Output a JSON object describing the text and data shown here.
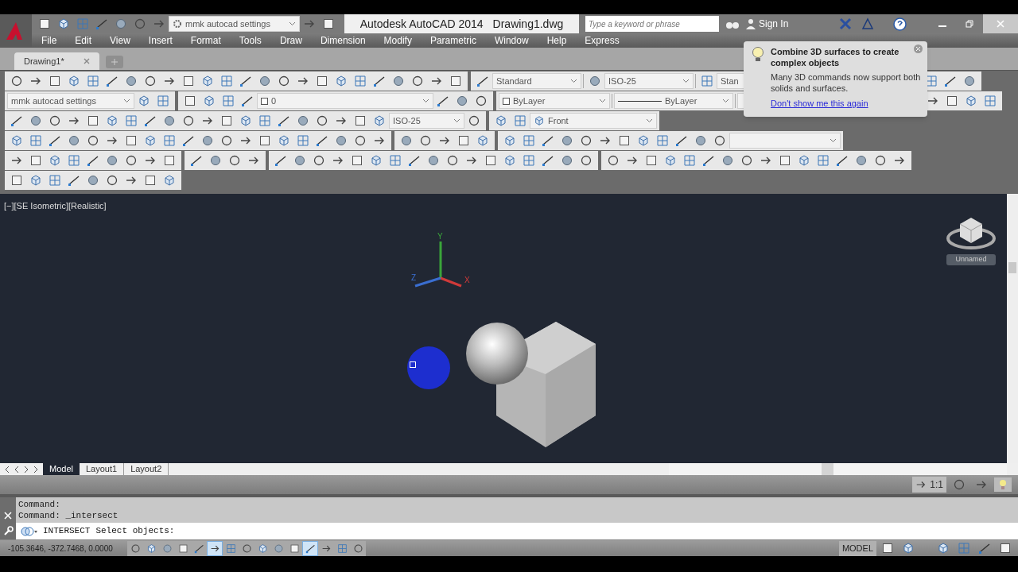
{
  "quick_access": {
    "workspace": "mmk autocad settings"
  },
  "title": {
    "app": "Autodesk AutoCAD 2014",
    "document": "Drawing1.dwg"
  },
  "search": {
    "placeholder": "Type a keyword or phrase"
  },
  "sign_in": "Sign In",
  "menu_bar": [
    "File",
    "Edit",
    "View",
    "Insert",
    "Format",
    "Tools",
    "Draw",
    "Dimension",
    "Modify",
    "Parametric",
    "Window",
    "Help",
    "Express"
  ],
  "file_tabs": [
    {
      "label": "Drawing1*",
      "selected": true
    }
  ],
  "toolbars": {
    "row_1": [
      "Standard",
      "ISO-25",
      "Stan"
    ],
    "row_2": [
      "mmk autocad settings",
      "0",
      "ByLayer",
      "ByLayer"
    ],
    "row_3": [
      "ISO-25",
      "Front"
    ]
  },
  "tooltip": {
    "title": "Combine 3D surfaces to create complex objects",
    "body": "Many 3D commands now support both solids and surfaces.",
    "link": "Don't show me this again"
  },
  "viewport": {
    "label": "[−][SE Isometric][Realistic]",
    "viewcube_label": "Unnamed",
    "axes": [
      "X",
      "Y",
      "Z"
    ]
  },
  "layout_tabs": [
    {
      "label": "Model",
      "selected": true
    },
    {
      "label": "Layout1",
      "selected": false
    },
    {
      "label": "Layout2",
      "selected": false
    }
  ],
  "annotation_scale": "1:1",
  "command_history": [
    "Command:",
    "Command: _intersect"
  ],
  "command_line": {
    "command": "INTERSECT",
    "prompt": "Select objects:"
  },
  "status_bar": {
    "coordinates": "-105.3646, -372.7468, 0.0000",
    "space": "MODEL"
  },
  "status_toggles": [
    {
      "on": false
    },
    {
      "on": false
    },
    {
      "on": false
    },
    {
      "on": false
    },
    {
      "on": false
    },
    {
      "on": true
    },
    {
      "on": false
    },
    {
      "on": false
    },
    {
      "on": false
    },
    {
      "on": false
    },
    {
      "on": false
    },
    {
      "on": true
    },
    {
      "on": false
    },
    {
      "on": false
    },
    {
      "on": false
    }
  ]
}
